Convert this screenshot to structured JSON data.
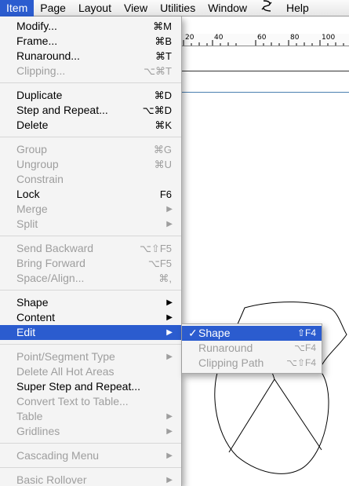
{
  "menubar": {
    "items": [
      "Item",
      "Page",
      "Layout",
      "View",
      "Utilities",
      "Window",
      "Help"
    ],
    "script_icon": "script-icon"
  },
  "ruler": {
    "labels": [
      "20",
      "40",
      "60",
      "80",
      "100"
    ]
  },
  "menu": {
    "modify": {
      "label": "Modify...",
      "shortcut": "⌘M"
    },
    "frame": {
      "label": "Frame...",
      "shortcut": "⌘B"
    },
    "runaround": {
      "label": "Runaround...",
      "shortcut": "⌘T"
    },
    "clipping": {
      "label": "Clipping...",
      "shortcut": "⌥⌘T"
    },
    "duplicate": {
      "label": "Duplicate",
      "shortcut": "⌘D"
    },
    "step_repeat": {
      "label": "Step and Repeat...",
      "shortcut": "⌥⌘D"
    },
    "delete": {
      "label": "Delete",
      "shortcut": "⌘K"
    },
    "group": {
      "label": "Group",
      "shortcut": "⌘G"
    },
    "ungroup": {
      "label": "Ungroup",
      "shortcut": "⌘U"
    },
    "constrain": {
      "label": "Constrain"
    },
    "lock": {
      "label": "Lock",
      "shortcut": "F6"
    },
    "merge": {
      "label": "Merge"
    },
    "split": {
      "label": "Split"
    },
    "send_backward": {
      "label": "Send Backward",
      "shortcut": "⌥⇧F5"
    },
    "bring_forward": {
      "label": "Bring Forward",
      "shortcut": "⌥F5"
    },
    "space_align": {
      "label": "Space/Align...",
      "shortcut": "⌘,"
    },
    "shape": {
      "label": "Shape"
    },
    "content": {
      "label": "Content"
    },
    "edit": {
      "label": "Edit"
    },
    "point_segment": {
      "label": "Point/Segment Type"
    },
    "delete_hot": {
      "label": "Delete All Hot Areas"
    },
    "super_step": {
      "label": "Super Step and Repeat..."
    },
    "convert_text": {
      "label": "Convert Text to Table..."
    },
    "table": {
      "label": "Table"
    },
    "gridlines": {
      "label": "Gridlines"
    },
    "cascading": {
      "label": "Cascading Menu"
    },
    "rollover": {
      "label": "Basic Rollover"
    }
  },
  "submenu": {
    "check": "✓",
    "shape": {
      "label": "Shape",
      "shortcut": "⇧F4"
    },
    "runaround": {
      "label": "Runaround",
      "shortcut": "⌥F4"
    },
    "clipping": {
      "label": "Clipping Path",
      "shortcut": "⌥⇧F4"
    }
  },
  "colors": {
    "highlight": "#2b5ccf",
    "disabled_text": "#9e9e9e",
    "menu_bg": "#f4f4f4"
  }
}
